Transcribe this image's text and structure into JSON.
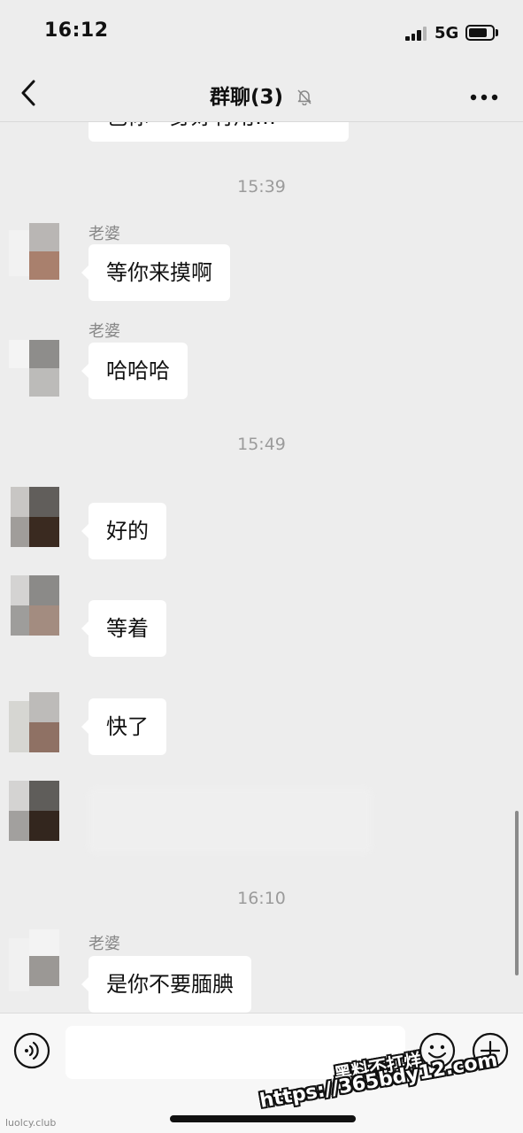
{
  "status_bar": {
    "time": "16:12",
    "network": "5G"
  },
  "nav": {
    "title": "群聊(3)",
    "back_icon": "chevron-left-icon",
    "mute_icon": "bell-off-icon",
    "more_icon": "more-dots-icon"
  },
  "chat": {
    "partial_message": "色你一身好有用…",
    "timestamps": [
      "15:39",
      "15:49",
      "16:10"
    ],
    "messages": [
      {
        "sender": "老婆",
        "text": "等你来摸啊"
      },
      {
        "sender": "老婆",
        "text": "哈哈哈"
      },
      {
        "sender": "",
        "text": "好的"
      },
      {
        "sender": "",
        "text": "等着"
      },
      {
        "sender": "",
        "text": "快了"
      },
      {
        "sender": "老婆",
        "text": "是你不要腼腆"
      }
    ]
  },
  "input_bar": {
    "value": "",
    "voice_icon": "voice-icon",
    "emoji_icon": "emoji-icon",
    "plus_icon": "plus-icon"
  },
  "watermark": {
    "site": "luolcy.club",
    "line1": "黑料不打烊",
    "line2": "https://365bdy12.com"
  },
  "colors": {
    "background": "#ededed",
    "bubble": "#ffffff",
    "timestamp": "#9b9b9b",
    "sender": "#888888"
  }
}
